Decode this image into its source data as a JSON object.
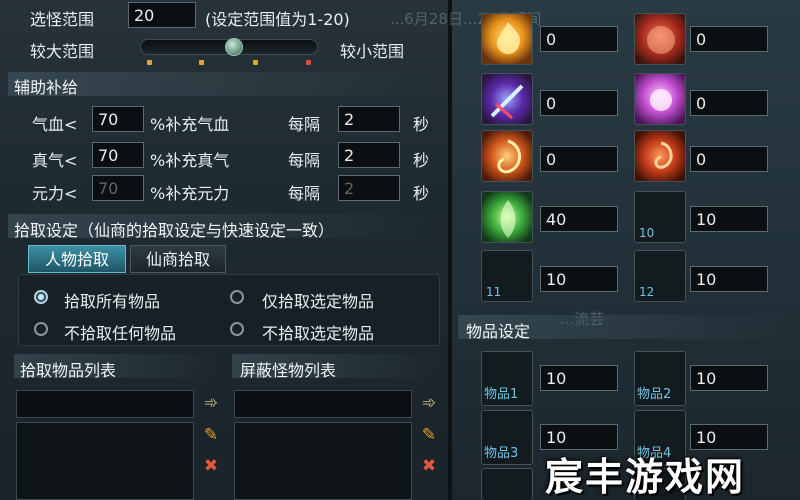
{
  "top": {
    "range_label": "选怪范围",
    "range_value": "20",
    "range_hint": "(设定范围值为1-20)",
    "faint_bg_text": "...6月28日...22日期间",
    "slider_left_label": "较大范围",
    "slider_right_label": "较小范围",
    "slider_value_fraction": 0.53
  },
  "supply": {
    "title": "辅助补给",
    "rows": [
      {
        "label": "气血<",
        "value": "70",
        "desc": "%补充气血",
        "interval_label": "每隔",
        "interval_value": "2",
        "unit": "秒",
        "disabled": false
      },
      {
        "label": "真气<",
        "value": "70",
        "desc": "%补充真气",
        "interval_label": "每隔",
        "interval_value": "2",
        "unit": "秒",
        "disabled": false
      },
      {
        "label": "元力<",
        "value": "70",
        "desc": "%补充元力",
        "interval_label": "每隔",
        "interval_value": "2",
        "unit": "秒",
        "disabled": true
      }
    ]
  },
  "pickup": {
    "title": "拾取设定（仙商的拾取设定与快速设定一致）",
    "tabs": [
      "人物拾取",
      "仙商拾取"
    ],
    "options": [
      "拾取所有物品",
      "仅拾取选定物品",
      "不拾取任何物品",
      "不拾取选定物品"
    ],
    "selected_option": 0
  },
  "lists": {
    "pickup_list_title": "拾取物品列表",
    "block_list_title": "屏蔽怪物列表"
  },
  "skills": {
    "slots": [
      {
        "value": "0",
        "num": ""
      },
      {
        "value": "0",
        "num": ""
      },
      {
        "value": "0",
        "num": ""
      },
      {
        "value": "0",
        "num": ""
      },
      {
        "value": "0",
        "num": ""
      },
      {
        "value": "0",
        "num": ""
      },
      {
        "value": "40",
        "num": ""
      },
      {
        "value": "10",
        "num": "10"
      },
      {
        "value": "10",
        "num": "11"
      },
      {
        "value": "10",
        "num": "12"
      }
    ],
    "faint_bg_text": "...流芸"
  },
  "items": {
    "title": "物品设定",
    "slots": [
      {
        "name": "物品1",
        "value": "10"
      },
      {
        "name": "物品2",
        "value": "10"
      },
      {
        "name": "物品3",
        "value": "10"
      },
      {
        "name": "物品4",
        "value": "10"
      }
    ]
  },
  "watermark": "宸丰游戏网",
  "colors": {
    "accent": "#3e8fa6",
    "slot_number": "#6fc3e6",
    "input_bg": "#0b0f11"
  }
}
